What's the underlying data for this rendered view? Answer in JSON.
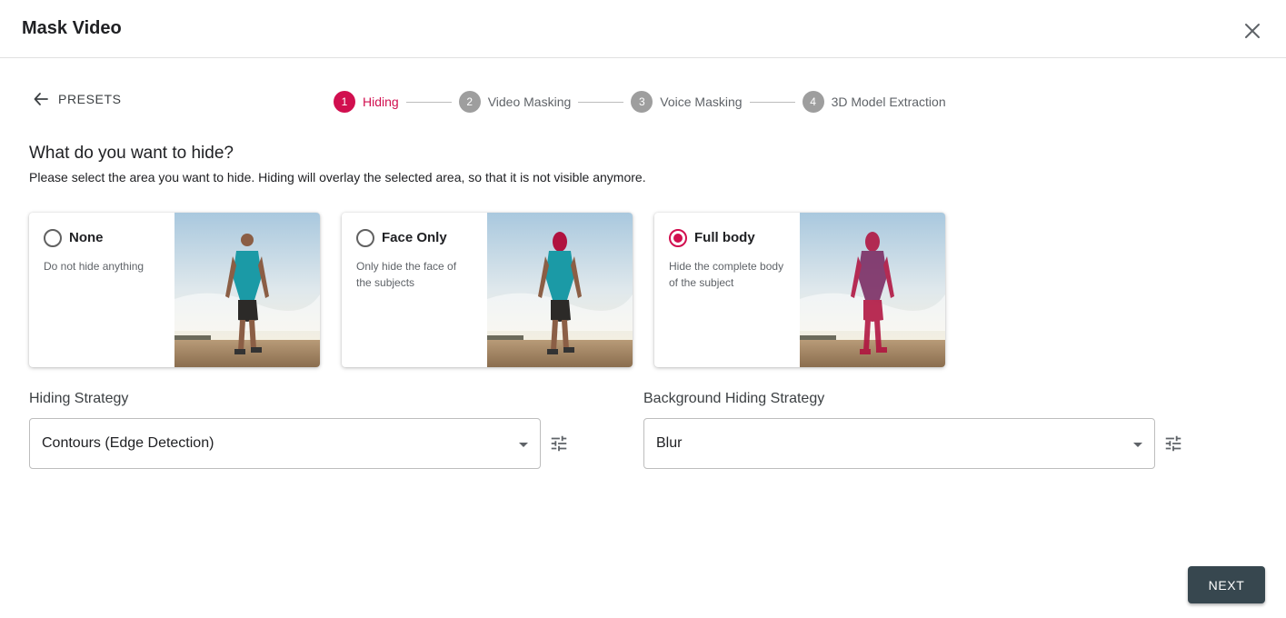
{
  "dialog": {
    "title": "Mask Video"
  },
  "nav": {
    "back_label": "PRESETS"
  },
  "stepper": {
    "steps": [
      {
        "number": "1",
        "label": "Hiding",
        "active": true
      },
      {
        "number": "2",
        "label": "Video Masking",
        "active": false
      },
      {
        "number": "3",
        "label": "Voice Masking",
        "active": false
      },
      {
        "number": "4",
        "label": "3D Model Extraction",
        "active": false
      }
    ]
  },
  "question": {
    "title": "What do you want to hide?",
    "description": "Please select the area you want to hide. Hiding will overlay the selected area, so that it is not visible anymore."
  },
  "options": [
    {
      "title": "None",
      "description": "Do not hide anything",
      "selected": false
    },
    {
      "title": "Face Only",
      "description": "Only hide the face of the subjects",
      "selected": false
    },
    {
      "title": "Full body",
      "description": "Hide the complete body of the subject",
      "selected": true
    }
  ],
  "hiding_strategy": {
    "label": "Hiding Strategy",
    "value": "Contours (Edge Detection)"
  },
  "background_strategy": {
    "label": "Background Hiding Strategy",
    "value": "Blur"
  },
  "actions": {
    "next_label": "NEXT"
  },
  "colors": {
    "accent": "#d10f4f",
    "button": "#37474f",
    "inactive_step": "#9e9e9e"
  }
}
